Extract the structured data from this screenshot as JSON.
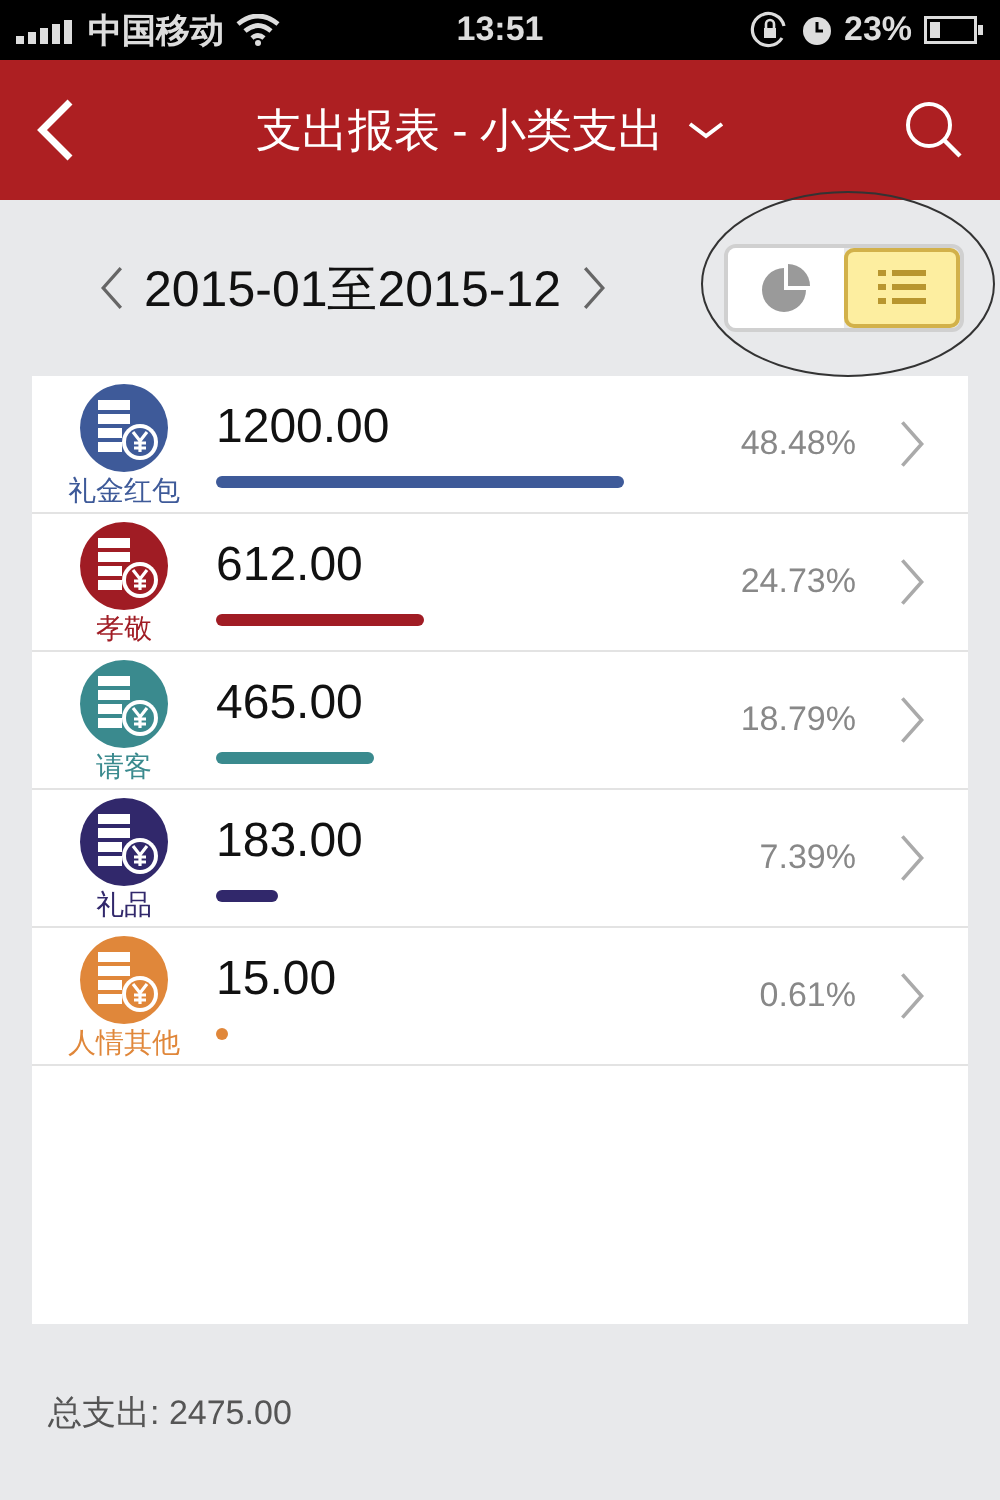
{
  "status_bar": {
    "carrier": "中国移动",
    "time": "13:51",
    "battery": "23%"
  },
  "nav": {
    "title": "支出报表 - 小类支出"
  },
  "period": {
    "range": "2015-01至2015-12"
  },
  "view_toggle": [
    {
      "kind": "pie",
      "selected": false
    },
    {
      "kind": "list",
      "selected": true
    }
  ],
  "categories": [
    {
      "name": "礼金红包",
      "amount": "1200.00",
      "percent": "48.48%",
      "color": "#3e5a99"
    },
    {
      "name": "孝敬",
      "amount": "612.00",
      "percent": "24.73%",
      "color": "#a01c24"
    },
    {
      "name": "请客",
      "amount": "465.00",
      "percent": "18.79%",
      "color": "#3a8a8e"
    },
    {
      "name": "礼品",
      "amount": "183.00",
      "percent": "7.39%",
      "color": "#31286b"
    },
    {
      "name": "人情其他",
      "amount": "15.00",
      "percent": "0.61%",
      "color": "#e0873a"
    }
  ],
  "total": {
    "text": "总支出: 2475.00"
  }
}
